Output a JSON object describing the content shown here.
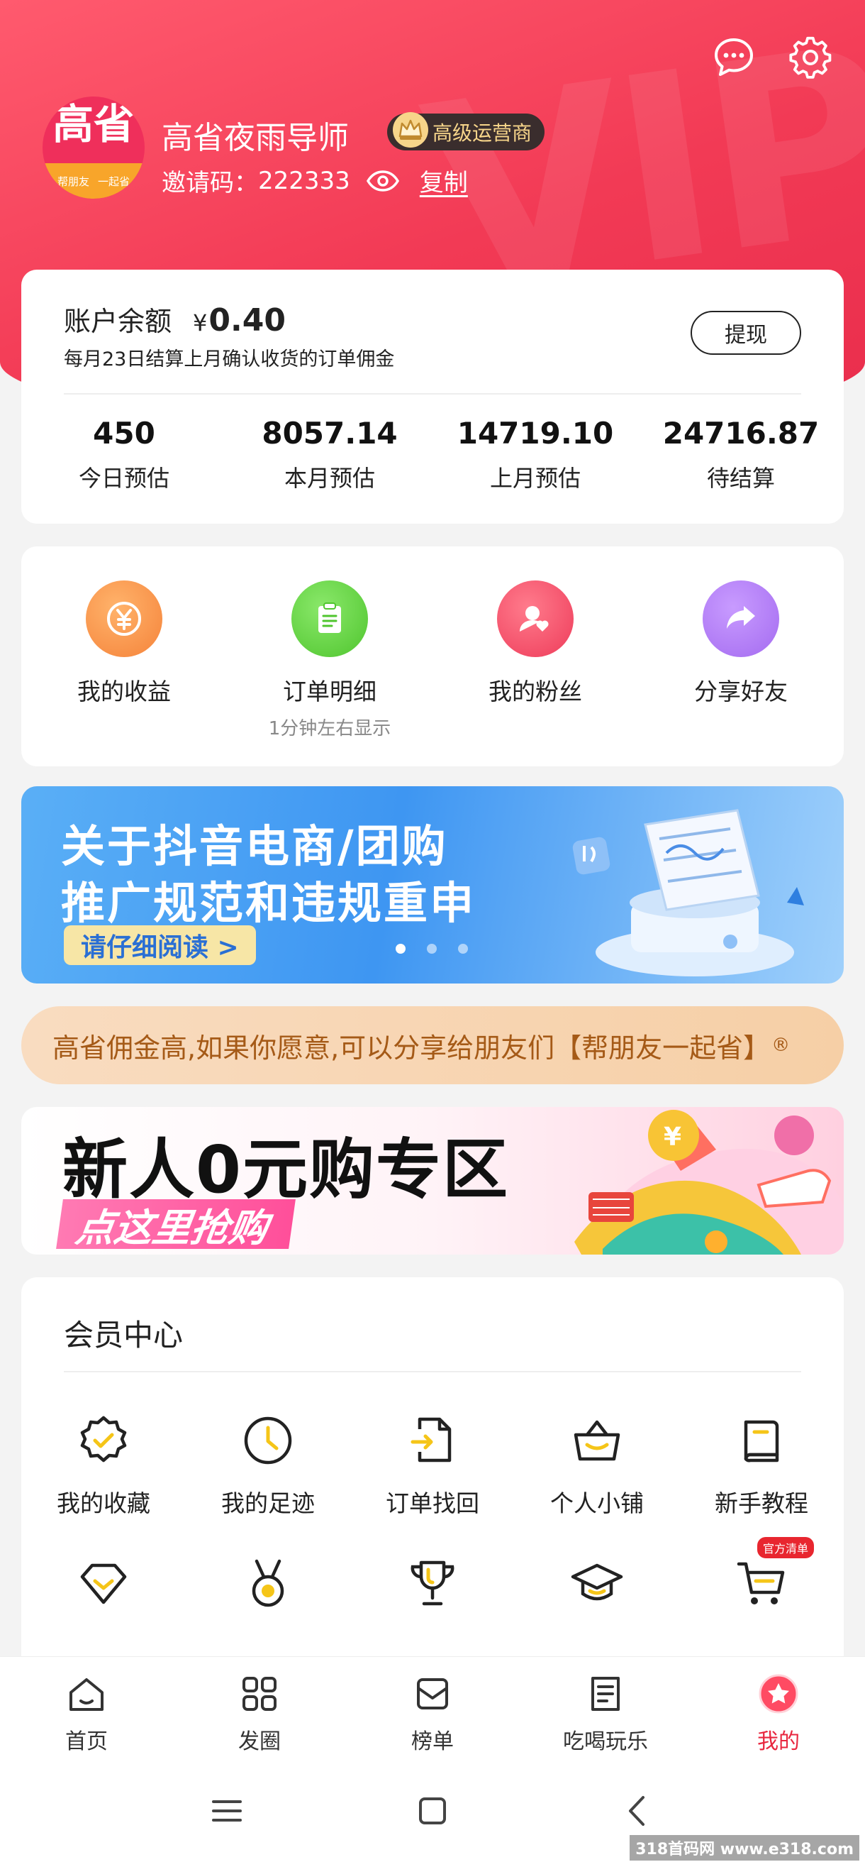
{
  "header": {
    "avatar_text": "高省",
    "avatar_strip": [
      "帮朋友",
      "一起省"
    ],
    "username": "高省夜雨导师",
    "badge": "高级运营商",
    "invite_label": "邀请码：",
    "invite_code": "222333",
    "copy_label": "复制",
    "icons": [
      "message-icon",
      "settings-icon"
    ]
  },
  "balance": {
    "title": "账户余额",
    "currency": "¥",
    "amount": "0.40",
    "note": "每月23日结算上月确认收货的订单佣金",
    "withdraw_label": "提现",
    "stats": [
      {
        "value": "450",
        "label": "今日预估"
      },
      {
        "value": "8057.14",
        "label": "本月预估"
      },
      {
        "value": "14719.10",
        "label": "上月预估"
      },
      {
        "value": "24716.87",
        "label": "待结算"
      }
    ]
  },
  "quick": [
    {
      "label": "我的收益",
      "sub": "",
      "icon": "yuan-icon",
      "color": "#f79a4a"
    },
    {
      "label": "订单明细",
      "sub": "1分钟左右显示",
      "icon": "clipboard-icon",
      "color": "#6bd24a"
    },
    {
      "label": "我的粉丝",
      "sub": "",
      "icon": "fans-icon",
      "color": "#f2556d"
    },
    {
      "label": "分享好友",
      "sub": "",
      "icon": "share-icon",
      "color": "#b17df2"
    }
  ],
  "banner": {
    "line1": "关于抖音电商/团购",
    "line2": "推广规范和违规重申",
    "cta": "请仔细阅读 >"
  },
  "slogan": {
    "text": "高省佣金高,如果你愿意,可以分享给朋友们【帮朋友一起省】",
    "mark": "®"
  },
  "promo": {
    "title": "新人0元购专区",
    "cta": "点这里抢购"
  },
  "member": {
    "title": "会员中心",
    "row1": [
      {
        "label": "我的收藏",
        "icon": "favorite-badge-icon"
      },
      {
        "label": "我的足迹",
        "icon": "clock-icon"
      },
      {
        "label": "订单找回",
        "icon": "file-import-icon"
      },
      {
        "label": "个人小铺",
        "icon": "basket-icon"
      },
      {
        "label": "新手教程",
        "icon": "book-icon"
      }
    ],
    "row2": [
      {
        "icon": "diamond-icon"
      },
      {
        "icon": "medal-icon"
      },
      {
        "icon": "trophy-icon"
      },
      {
        "icon": "graduation-cap-icon"
      },
      {
        "icon": "cart-icon",
        "tag": "官方清单"
      }
    ]
  },
  "nav": [
    {
      "label": "首页",
      "icon": "home-icon"
    },
    {
      "label": "发圈",
      "icon": "grid-icon"
    },
    {
      "label": "榜单",
      "icon": "ranking-icon"
    },
    {
      "label": "吃喝玩乐",
      "icon": "document-icon"
    },
    {
      "label": "我的",
      "icon": "star-circle-icon",
      "active": true
    }
  ],
  "accent_color": "#e8273f",
  "site_watermark": "318首码网 www.e318.com"
}
